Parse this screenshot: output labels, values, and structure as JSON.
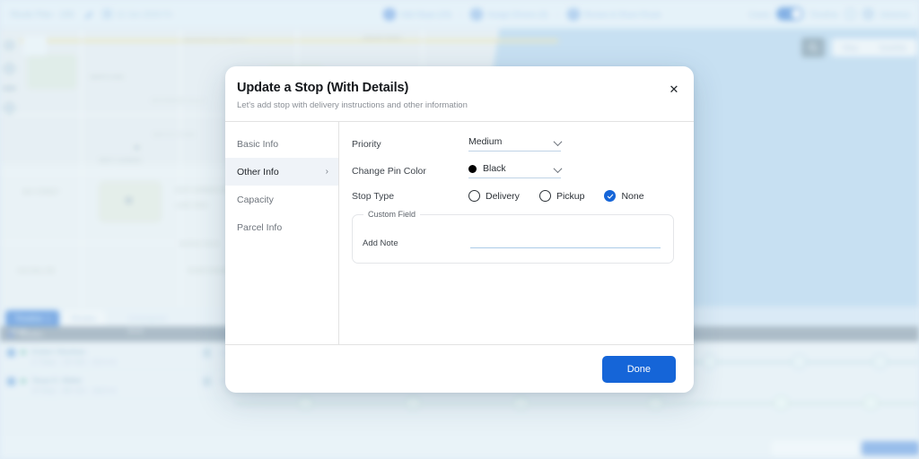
{
  "app": {
    "topbar": {
      "plan_title": "Route Plan - 205",
      "edit_icon": "pencil-icon",
      "date_icon": "calendar-icon",
      "date_text": "12 Jun 2024 Fri",
      "steps": [
        {
          "num": "1",
          "label": "Add Stops (24)"
        },
        {
          "num": "2",
          "label": "Assign Drivers (3)"
        },
        {
          "num": "3",
          "label": "Review & Share Route"
        }
      ],
      "step_separator": "›",
      "left_toggle_label": "Cases",
      "right_toggle_label": "Timeline",
      "toggle_on": true,
      "help_icon": "help-circle-icon",
      "user_icon": "user-avatar-icon",
      "user_label": "Advance"
    },
    "map": {
      "search_icon": "search-icon",
      "view_modes": [
        "Map",
        "Satellite"
      ],
      "active_view_mode": "Map",
      "tools": [
        "layers-icon",
        "location-pin-icon",
        "plus-icon",
        "minus-icon",
        "polygon-icon"
      ],
      "labels": [
        "MENDOCINO FOREST",
        "JEFFERSON HILLS",
        "SMITH'S FORK",
        "WEST GARDEN",
        "EAST HARBOR DR",
        "LAKE VIEW",
        "MARINA ROAD",
        "RIVER PARKWAY",
        "CEDAR POINT",
        "OLD MILL RD",
        "BAY STREET",
        "NORTH END"
      ]
    },
    "bottom_panel": {
      "tabs": [
        {
          "label": "Timeline",
          "count": "3",
          "active": true
        },
        {
          "label": "Routes",
          "count": "",
          "active": false
        }
      ],
      "extra_tab_label": "Unassigned",
      "list_title": "Routes",
      "list_count_pill": "24 hrs",
      "rows": [
        {
          "title": "Kristen Okonkwo",
          "subtitle": "27 Stops · 12h 40m · 210.4 mi"
        },
        {
          "title": "Tanya D. Walter",
          "subtitle": "18 Stops · 09h 10m · 148.6 mi"
        }
      ],
      "timeline": {
        "ticks": [
          "06:00",
          "09:00",
          "12:00",
          "15:00",
          "18:00"
        ],
        "chips": [
          "8 / 12",
          "5 / 9"
        ]
      }
    }
  },
  "modal": {
    "title": "Update a Stop (With Details)",
    "subtitle": "Let's add stop with delivery instructions and other information",
    "close_icon": "close-icon",
    "nav": [
      {
        "label": "Basic Info",
        "active": false,
        "chevron": ""
      },
      {
        "label": "Other Info",
        "active": true,
        "chevron": "›"
      },
      {
        "label": "Capacity",
        "active": false,
        "chevron": ""
      },
      {
        "label": "Parcel Info",
        "active": false,
        "chevron": ""
      }
    ],
    "form": {
      "priority": {
        "label": "Priority",
        "value": "Medium",
        "chevron_icon": "chevron-down-icon"
      },
      "pin_color": {
        "label": "Change Pin Color",
        "value": "Black",
        "swatch_hex": "#000000",
        "swatch_icon": "color-dot-icon",
        "chevron_icon": "chevron-down-icon"
      },
      "stop_type": {
        "label": "Stop Type",
        "options": [
          {
            "label": "Delivery",
            "selected": false
          },
          {
            "label": "Pickup",
            "selected": false
          },
          {
            "label": "None",
            "selected": true
          }
        ],
        "check_icon": "check-icon"
      },
      "custom_field": {
        "legend": "Custom Field",
        "note_label": "Add Note",
        "note_value": "",
        "note_placeholder": ""
      }
    },
    "footer": {
      "done_label": "Done"
    }
  },
  "colors": {
    "accent": "#1565d8",
    "nav_active_bg": "#eff3f8",
    "water": "#aed4f0",
    "underline": "#accbe8"
  }
}
